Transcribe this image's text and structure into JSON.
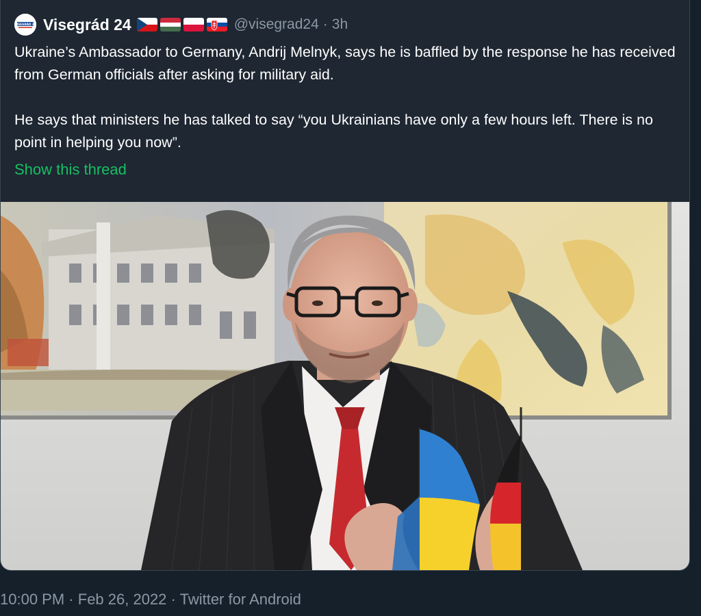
{
  "tweet": {
    "display_name": "Visegrád 24",
    "flags": [
      "czech-flag",
      "hungary-flag",
      "poland-flag",
      "slovakia-flag"
    ],
    "handle": "@visegrad24",
    "separator": "·",
    "time_ago": "3h",
    "paragraphs": [
      "Ukraine’s Ambassador to Germany, Andrij Melnyk, says he is baffled by the response he has received from German officials after asking for military aid.",
      "He says that ministers he has talked to say “you Ukrainians have only a few hours left. There is no point in helping you now”."
    ],
    "show_thread": "Show this thread",
    "avatar_text": "VISEGRÁD 24"
  },
  "meta": {
    "time": "10:00 PM",
    "dot": "·",
    "date": "Feb 26, 2022",
    "source": "Twitter for Android"
  },
  "colors": {
    "background": "#15202b",
    "card": "#1e2732",
    "muted": "#8b98a5",
    "link": "#17bf63"
  }
}
